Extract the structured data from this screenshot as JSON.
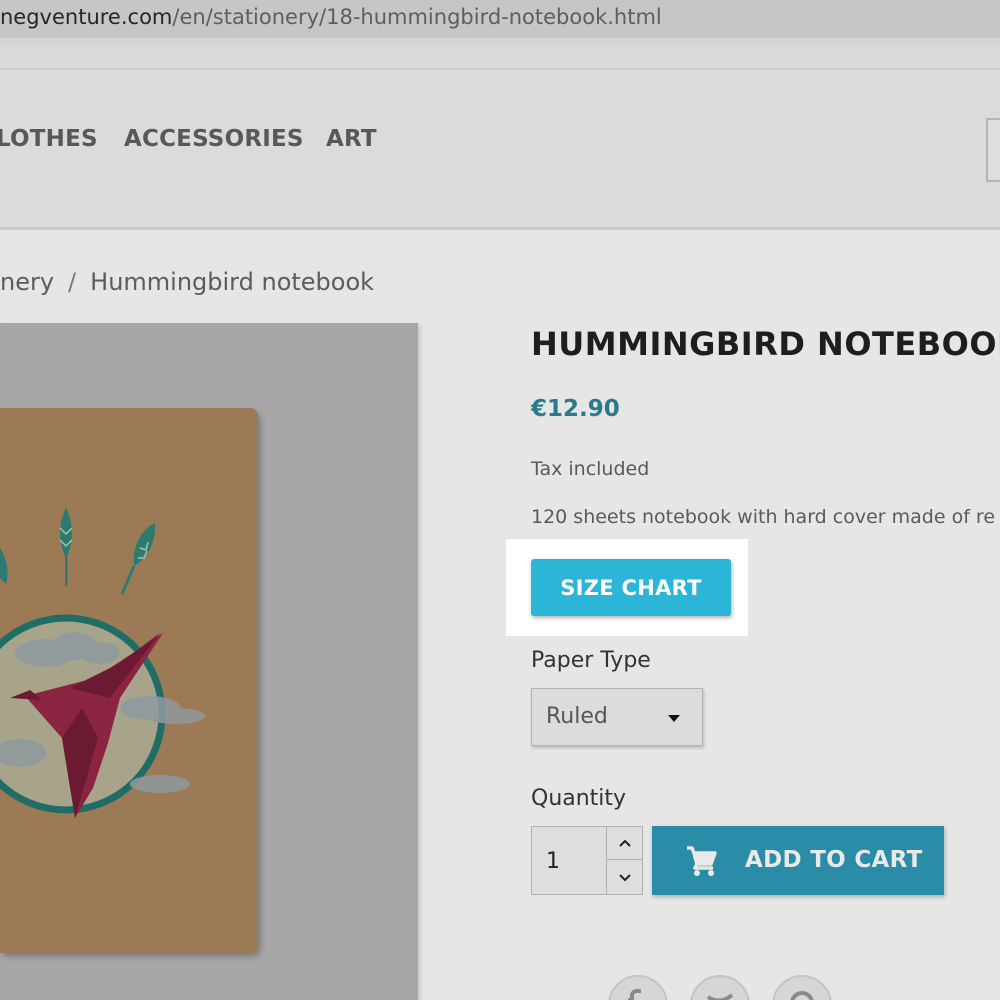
{
  "browser": {
    "url_host": "negventure.com",
    "url_path": "/en/stationery/18-hummingbird-notebook.html"
  },
  "nav": {
    "items": [
      "LOTHES",
      "ACCESSORIES",
      "ART"
    ]
  },
  "breadcrumb": {
    "parent": "nery",
    "separator": "/",
    "current": "Hummingbird notebook"
  },
  "product": {
    "title": "HUMMINGBIRD NOTEBOOK",
    "price": "€12.90",
    "tax_label": "Tax included",
    "description": "120 sheets notebook with hard cover made of re",
    "size_chart_label": "SIZE CHART",
    "paper_type_label": "Paper Type",
    "paper_type_value": "Ruled",
    "quantity_label": "Quantity",
    "quantity_value": "1",
    "add_to_cart_label": "ADD TO CART"
  },
  "colors": {
    "size_chart_button": "#2bb5d6",
    "add_to_cart_button": "#2b8ca7",
    "price": "#2a7a8c",
    "dim_overlay": "#e6e6e6",
    "highlight": "#ffffff"
  },
  "icons": [
    "cart-icon",
    "chevron-up-icon",
    "chevron-down-icon",
    "caret-down-icon",
    "facebook-icon",
    "twitter-icon",
    "pinterest-icon"
  ]
}
